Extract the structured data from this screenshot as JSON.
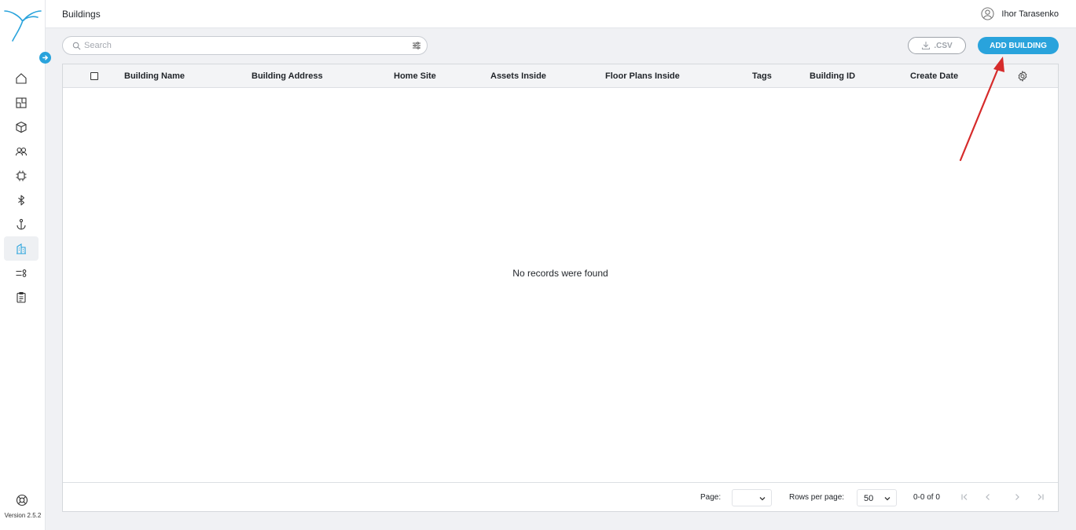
{
  "app": {
    "version": "Version 2.5.2"
  },
  "header": {
    "title": "Buildings",
    "user_name": "Ihor Tarasenko"
  },
  "sidebar": {
    "items": [
      {
        "icon": "home-icon"
      },
      {
        "icon": "floor-plan-icon"
      },
      {
        "icon": "cube-icon"
      },
      {
        "icon": "users-icon"
      },
      {
        "icon": "chip-icon"
      },
      {
        "icon": "bluetooth-icon"
      },
      {
        "icon": "anchor-icon"
      },
      {
        "icon": "building-icon",
        "active": true
      },
      {
        "icon": "rules-icon"
      },
      {
        "icon": "reports-icon"
      }
    ]
  },
  "toolbar": {
    "search_placeholder": "Search",
    "csv_label": ".CSV",
    "add_label": "ADD BUILDING"
  },
  "table": {
    "columns": [
      "Building Name",
      "Building Address",
      "Home Site",
      "Assets Inside",
      "Floor Plans Inside",
      "Tags",
      "Building ID",
      "Create Date"
    ],
    "empty_text": "No records were found"
  },
  "pagination": {
    "page_label": "Page:",
    "rows_label": "Rows per page:",
    "rows_value": "50",
    "range_text": "0-0 of 0"
  },
  "colors": {
    "accent": "#29a3dc",
    "annotation_arrow": "#d62b2b"
  }
}
